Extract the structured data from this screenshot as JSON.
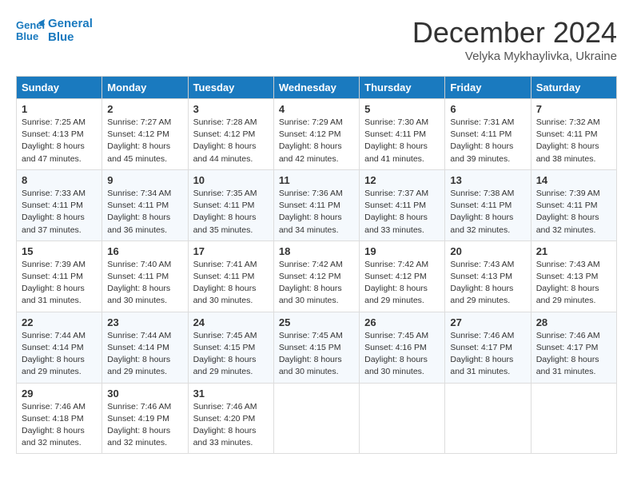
{
  "header": {
    "logo_line1": "General",
    "logo_line2": "Blue",
    "month": "December 2024",
    "location": "Velyka Mykhaylivka, Ukraine"
  },
  "days_of_week": [
    "Sunday",
    "Monday",
    "Tuesday",
    "Wednesday",
    "Thursday",
    "Friday",
    "Saturday"
  ],
  "weeks": [
    [
      {
        "day": "1",
        "sunrise": "Sunrise: 7:25 AM",
        "sunset": "Sunset: 4:13 PM",
        "daylight": "Daylight: 8 hours and 47 minutes."
      },
      {
        "day": "2",
        "sunrise": "Sunrise: 7:27 AM",
        "sunset": "Sunset: 4:12 PM",
        "daylight": "Daylight: 8 hours and 45 minutes."
      },
      {
        "day": "3",
        "sunrise": "Sunrise: 7:28 AM",
        "sunset": "Sunset: 4:12 PM",
        "daylight": "Daylight: 8 hours and 44 minutes."
      },
      {
        "day": "4",
        "sunrise": "Sunrise: 7:29 AM",
        "sunset": "Sunset: 4:12 PM",
        "daylight": "Daylight: 8 hours and 42 minutes."
      },
      {
        "day": "5",
        "sunrise": "Sunrise: 7:30 AM",
        "sunset": "Sunset: 4:11 PM",
        "daylight": "Daylight: 8 hours and 41 minutes."
      },
      {
        "day": "6",
        "sunrise": "Sunrise: 7:31 AM",
        "sunset": "Sunset: 4:11 PM",
        "daylight": "Daylight: 8 hours and 39 minutes."
      },
      {
        "day": "7",
        "sunrise": "Sunrise: 7:32 AM",
        "sunset": "Sunset: 4:11 PM",
        "daylight": "Daylight: 8 hours and 38 minutes."
      }
    ],
    [
      {
        "day": "8",
        "sunrise": "Sunrise: 7:33 AM",
        "sunset": "Sunset: 4:11 PM",
        "daylight": "Daylight: 8 hours and 37 minutes."
      },
      {
        "day": "9",
        "sunrise": "Sunrise: 7:34 AM",
        "sunset": "Sunset: 4:11 PM",
        "daylight": "Daylight: 8 hours and 36 minutes."
      },
      {
        "day": "10",
        "sunrise": "Sunrise: 7:35 AM",
        "sunset": "Sunset: 4:11 PM",
        "daylight": "Daylight: 8 hours and 35 minutes."
      },
      {
        "day": "11",
        "sunrise": "Sunrise: 7:36 AM",
        "sunset": "Sunset: 4:11 PM",
        "daylight": "Daylight: 8 hours and 34 minutes."
      },
      {
        "day": "12",
        "sunrise": "Sunrise: 7:37 AM",
        "sunset": "Sunset: 4:11 PM",
        "daylight": "Daylight: 8 hours and 33 minutes."
      },
      {
        "day": "13",
        "sunrise": "Sunrise: 7:38 AM",
        "sunset": "Sunset: 4:11 PM",
        "daylight": "Daylight: 8 hours and 32 minutes."
      },
      {
        "day": "14",
        "sunrise": "Sunrise: 7:39 AM",
        "sunset": "Sunset: 4:11 PM",
        "daylight": "Daylight: 8 hours and 32 minutes."
      }
    ],
    [
      {
        "day": "15",
        "sunrise": "Sunrise: 7:39 AM",
        "sunset": "Sunset: 4:11 PM",
        "daylight": "Daylight: 8 hours and 31 minutes."
      },
      {
        "day": "16",
        "sunrise": "Sunrise: 7:40 AM",
        "sunset": "Sunset: 4:11 PM",
        "daylight": "Daylight: 8 hours and 30 minutes."
      },
      {
        "day": "17",
        "sunrise": "Sunrise: 7:41 AM",
        "sunset": "Sunset: 4:11 PM",
        "daylight": "Daylight: 8 hours and 30 minutes."
      },
      {
        "day": "18",
        "sunrise": "Sunrise: 7:42 AM",
        "sunset": "Sunset: 4:12 PM",
        "daylight": "Daylight: 8 hours and 30 minutes."
      },
      {
        "day": "19",
        "sunrise": "Sunrise: 7:42 AM",
        "sunset": "Sunset: 4:12 PM",
        "daylight": "Daylight: 8 hours and 29 minutes."
      },
      {
        "day": "20",
        "sunrise": "Sunrise: 7:43 AM",
        "sunset": "Sunset: 4:13 PM",
        "daylight": "Daylight: 8 hours and 29 minutes."
      },
      {
        "day": "21",
        "sunrise": "Sunrise: 7:43 AM",
        "sunset": "Sunset: 4:13 PM",
        "daylight": "Daylight: 8 hours and 29 minutes."
      }
    ],
    [
      {
        "day": "22",
        "sunrise": "Sunrise: 7:44 AM",
        "sunset": "Sunset: 4:14 PM",
        "daylight": "Daylight: 8 hours and 29 minutes."
      },
      {
        "day": "23",
        "sunrise": "Sunrise: 7:44 AM",
        "sunset": "Sunset: 4:14 PM",
        "daylight": "Daylight: 8 hours and 29 minutes."
      },
      {
        "day": "24",
        "sunrise": "Sunrise: 7:45 AM",
        "sunset": "Sunset: 4:15 PM",
        "daylight": "Daylight: 8 hours and 29 minutes."
      },
      {
        "day": "25",
        "sunrise": "Sunrise: 7:45 AM",
        "sunset": "Sunset: 4:15 PM",
        "daylight": "Daylight: 8 hours and 30 minutes."
      },
      {
        "day": "26",
        "sunrise": "Sunrise: 7:45 AM",
        "sunset": "Sunset: 4:16 PM",
        "daylight": "Daylight: 8 hours and 30 minutes."
      },
      {
        "day": "27",
        "sunrise": "Sunrise: 7:46 AM",
        "sunset": "Sunset: 4:17 PM",
        "daylight": "Daylight: 8 hours and 31 minutes."
      },
      {
        "day": "28",
        "sunrise": "Sunrise: 7:46 AM",
        "sunset": "Sunset: 4:17 PM",
        "daylight": "Daylight: 8 hours and 31 minutes."
      }
    ],
    [
      {
        "day": "29",
        "sunrise": "Sunrise: 7:46 AM",
        "sunset": "Sunset: 4:18 PM",
        "daylight": "Daylight: 8 hours and 32 minutes."
      },
      {
        "day": "30",
        "sunrise": "Sunrise: 7:46 AM",
        "sunset": "Sunset: 4:19 PM",
        "daylight": "Daylight: 8 hours and 32 minutes."
      },
      {
        "day": "31",
        "sunrise": "Sunrise: 7:46 AM",
        "sunset": "Sunset: 4:20 PM",
        "daylight": "Daylight: 8 hours and 33 minutes."
      },
      null,
      null,
      null,
      null
    ]
  ]
}
